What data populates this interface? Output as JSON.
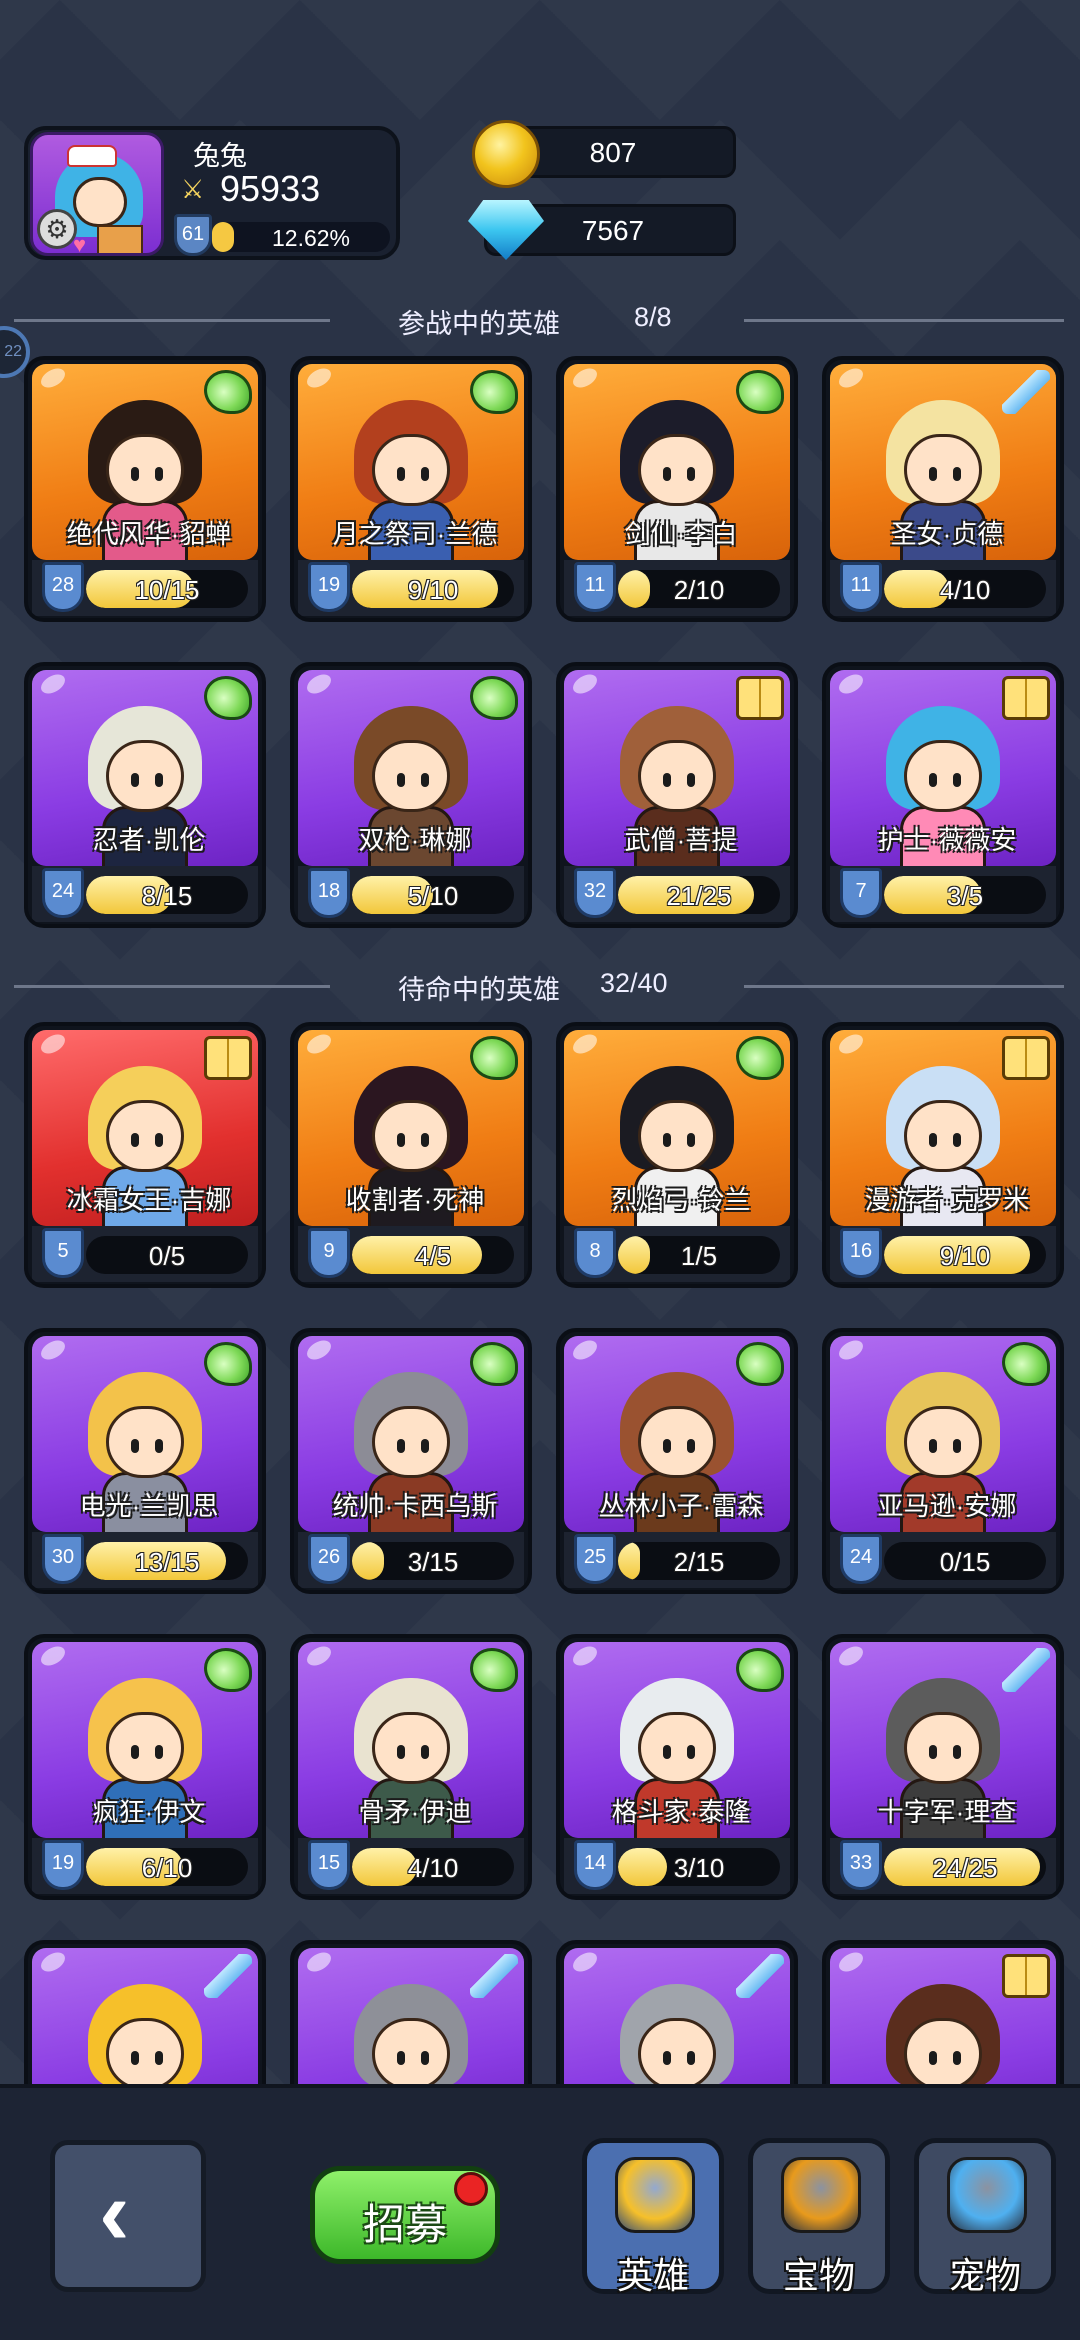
{
  "player": {
    "name": "兔兔",
    "power": "95933",
    "level": "61",
    "exp_percent": "12.62%",
    "exp_fraction": 0.1262
  },
  "currency": {
    "gold": "807",
    "gems": "7567"
  },
  "side_badge": "22",
  "sections": {
    "active": {
      "title": "参战中的英雄",
      "count": "8/8"
    },
    "standby": {
      "title": "待命中的英雄",
      "count": "32/40"
    }
  },
  "active_heroes": [
    {
      "name": "绝代风华·貂蝉",
      "level": "28",
      "shards": "10/15",
      "progress": 0.667,
      "rarity": "orange",
      "class_icon": "wing-icon",
      "hair": "#2a1b14",
      "outfit": "#e35a8a"
    },
    {
      "name": "月之祭司·兰德",
      "level": "19",
      "shards": "9/10",
      "progress": 0.9,
      "rarity": "orange",
      "class_icon": "wing-icon",
      "hair": "#b3401e",
      "outfit": "#3a5fb0"
    },
    {
      "name": "剑仙·李白",
      "level": "11",
      "shards": "2/10",
      "progress": 0.2,
      "rarity": "orange",
      "class_icon": "wing-icon",
      "hair": "#1c1c2a",
      "outfit": "#e8e8e8"
    },
    {
      "name": "圣女·贞德",
      "level": "11",
      "shards": "4/10",
      "progress": 0.4,
      "rarity": "orange",
      "class_icon": "sword-icon",
      "hair": "#f4e3a1",
      "outfit": "#3b4a8a"
    },
    {
      "name": "忍者·凯伦",
      "level": "24",
      "shards": "8/15",
      "progress": 0.533,
      "rarity": "purple",
      "class_icon": "wing-icon",
      "hair": "#e6e6d8",
      "outfit": "#1d2540"
    },
    {
      "name": "双枪·琳娜",
      "level": "18",
      "shards": "5/10",
      "progress": 0.5,
      "rarity": "purple",
      "class_icon": "wing-icon",
      "hair": "#7a4a28",
      "outfit": "#6b4730"
    },
    {
      "name": "武僧·菩提",
      "level": "32",
      "shards": "21/25",
      "progress": 0.84,
      "rarity": "purple",
      "class_icon": "book-icon",
      "hair": "#a0603a",
      "outfit": "#5a2d1d"
    },
    {
      "name": "护士·薇薇安",
      "level": "7",
      "shards": "3/5",
      "progress": 0.6,
      "rarity": "purple",
      "class_icon": "book-icon",
      "hair": "#3fb3e6",
      "outfit": "#ff8ab6"
    }
  ],
  "standby_heroes": [
    {
      "name": "冰霜女王·吉娜",
      "level": "5",
      "shards": "0/5",
      "progress": 0.0,
      "rarity": "red",
      "class_icon": "book-icon",
      "hair": "#f5cf5a",
      "outfit": "#6ea8e8"
    },
    {
      "name": "收割者·死神",
      "level": "9",
      "shards": "4/5",
      "progress": 0.8,
      "rarity": "orange",
      "class_icon": "wing-icon",
      "hair": "#2b1620",
      "outfit": "#1e1a20"
    },
    {
      "name": "烈焰弓·铃兰",
      "level": "8",
      "shards": "1/5",
      "progress": 0.2,
      "rarity": "orange",
      "class_icon": "wing-icon",
      "hair": "#1b1b22",
      "outfit": "#f0f0f0"
    },
    {
      "name": "漫游者·克罗米",
      "level": "16",
      "shards": "9/10",
      "progress": 0.9,
      "rarity": "orange",
      "class_icon": "book-icon",
      "hair": "#c9dff5",
      "outfit": "#e8e8f2"
    },
    {
      "name": "电光·兰凯思",
      "level": "30",
      "shards": "13/15",
      "progress": 0.867,
      "rarity": "purple",
      "class_icon": "wing-icon",
      "hair": "#f3c24a",
      "outfit": "#8a8fa0"
    },
    {
      "name": "统帅·卡西乌斯",
      "level": "26",
      "shards": "3/15",
      "progress": 0.2,
      "rarity": "purple",
      "class_icon": "wing-icon",
      "hair": "#8c8c96",
      "outfit": "#8a3a24"
    },
    {
      "name": "丛林小子·雷森",
      "level": "25",
      "shards": "2/15",
      "progress": 0.133,
      "rarity": "purple",
      "class_icon": "wing-icon",
      "hair": "#9a5230",
      "outfit": "#6b3a1c"
    },
    {
      "name": "亚马逊·安娜",
      "level": "24",
      "shards": "0/15",
      "progress": 0.0,
      "rarity": "purple",
      "class_icon": "wing-icon",
      "hair": "#e7c45a",
      "outfit": "#a23a2a"
    },
    {
      "name": "疯狂·伊文",
      "level": "19",
      "shards": "6/10",
      "progress": 0.6,
      "rarity": "purple",
      "class_icon": "wing-icon",
      "hair": "#f6c24c",
      "outfit": "#2f6fb8"
    },
    {
      "name": "骨矛·伊迪",
      "level": "15",
      "shards": "4/10",
      "progress": 0.4,
      "rarity": "purple",
      "class_icon": "wing-icon",
      "hair": "#e9e3d0",
      "outfit": "#3d5a4a"
    },
    {
      "name": "格斗家·泰隆",
      "level": "14",
      "shards": "3/10",
      "progress": 0.3,
      "rarity": "purple",
      "class_icon": "wing-icon",
      "hair": "#e8ecef",
      "outfit": "#c0392b"
    },
    {
      "name": "十字军·理查",
      "level": "33",
      "shards": "24/25",
      "progress": 0.96,
      "rarity": "purple",
      "class_icon": "sword-icon",
      "hair": "#5c5c5c",
      "outfit": "#3d3d3d"
    },
    {
      "name": "",
      "level": "",
      "shards": "",
      "progress": 0.0,
      "rarity": "purple",
      "class_icon": "sword-icon",
      "hair": "#f6c02a",
      "outfit": "#9a9a9a"
    },
    {
      "name": "",
      "level": "",
      "shards": "",
      "progress": 0.0,
      "rarity": "purple",
      "class_icon": "sword-icon",
      "hair": "#8e9098",
      "outfit": "#5c5c64"
    },
    {
      "name": "",
      "level": "",
      "shards": "",
      "progress": 0.0,
      "rarity": "purple",
      "class_icon": "sword-icon",
      "hair": "#a0a4ab",
      "outfit": "#d98b2a"
    },
    {
      "name": "",
      "level": "",
      "shards": "",
      "progress": 0.0,
      "rarity": "purple",
      "class_icon": "book-icon",
      "hair": "#5a2d1d",
      "outfit": "#2a9d6a"
    }
  ],
  "nav": {
    "back_icon": "back-arrow-icon",
    "recruit_label": "招募",
    "tabs": [
      {
        "label": "英雄",
        "icon": "hero-icon",
        "active": true,
        "color": "#f6c02a"
      },
      {
        "label": "宝物",
        "icon": "treasure-icon",
        "active": false,
        "color": "#e89a1c"
      },
      {
        "label": "宠物",
        "icon": "pet-icon",
        "active": false,
        "color": "#4fb0f0"
      }
    ]
  }
}
